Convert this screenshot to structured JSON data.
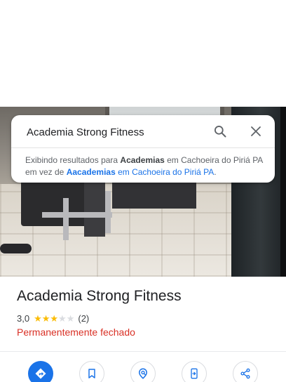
{
  "search": {
    "query": "Academia Strong Fitness",
    "search_icon": "search-icon",
    "close_icon": "close-icon"
  },
  "notice": {
    "prefix": "Exibindo resultados para ",
    "shown_term": "Academias",
    "shown_location": " em Cachoeira do Piriá PA",
    "middle": " em vez de ",
    "original_term": "Aacademias",
    "original_location": " em Cachoeira do Piriá PA",
    "suffix": "."
  },
  "place": {
    "name": "Academia Strong Fitness",
    "rating": "3,0",
    "stars_filled": 3,
    "stars_total": 5,
    "reviews": "(2)",
    "status": "Permanentemente fechado"
  },
  "actions": [
    {
      "icon": "directions-icon"
    },
    {
      "icon": "bookmark-icon"
    },
    {
      "icon": "nearby-icon"
    },
    {
      "icon": "send-to-phone-icon"
    },
    {
      "icon": "share-icon"
    }
  ],
  "colors": {
    "accent": "#1a73e8",
    "star": "#fbbc04",
    "closed": "#d93025"
  }
}
